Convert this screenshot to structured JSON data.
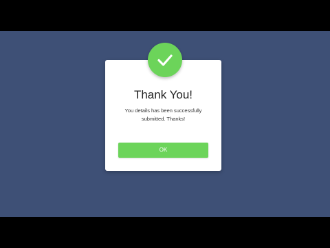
{
  "dialog": {
    "title": "Thank You!",
    "message": "You details has been successfully submitted. Thanks!",
    "ok_label": "OK",
    "icon": "check-icon"
  },
  "colors": {
    "background": "#3e5076",
    "letterbox": "#000000",
    "accent": "#6cd45a",
    "card": "#ffffff"
  }
}
